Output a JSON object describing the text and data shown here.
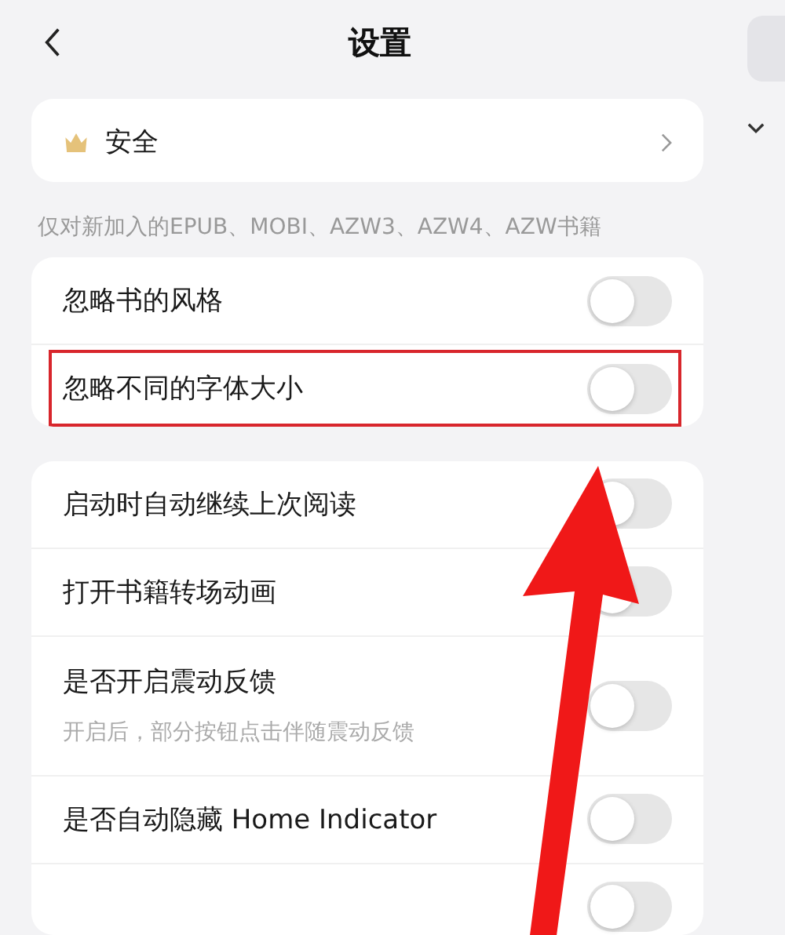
{
  "header": {
    "title": "设置"
  },
  "sections": [
    {
      "items": [
        {
          "kind": "link",
          "label": "安全"
        }
      ]
    },
    {
      "note": "仅对新加入的EPUB、MOBI、AZW3、AZW4、AZW书籍",
      "items": [
        {
          "kind": "toggle",
          "label": "忽略书的风格",
          "on": false,
          "highlighted": false
        },
        {
          "kind": "toggle",
          "label": "忽略不同的字体大小",
          "on": false,
          "highlighted": true
        }
      ]
    },
    {
      "items": [
        {
          "kind": "toggle",
          "label": "启动时自动继续上次阅读",
          "on": false
        },
        {
          "kind": "toggle",
          "label": "打开书籍转场动画",
          "on": false
        },
        {
          "kind": "toggle",
          "label": "是否开启震动反馈",
          "description": "开启后，部分按钮点击伴随震动反馈",
          "on": false
        },
        {
          "kind": "toggle",
          "label": "是否自动隐藏 Home Indicator",
          "on": false
        },
        {
          "kind": "toggle",
          "on": false
        }
      ]
    }
  ],
  "pointer_arrow": true
}
